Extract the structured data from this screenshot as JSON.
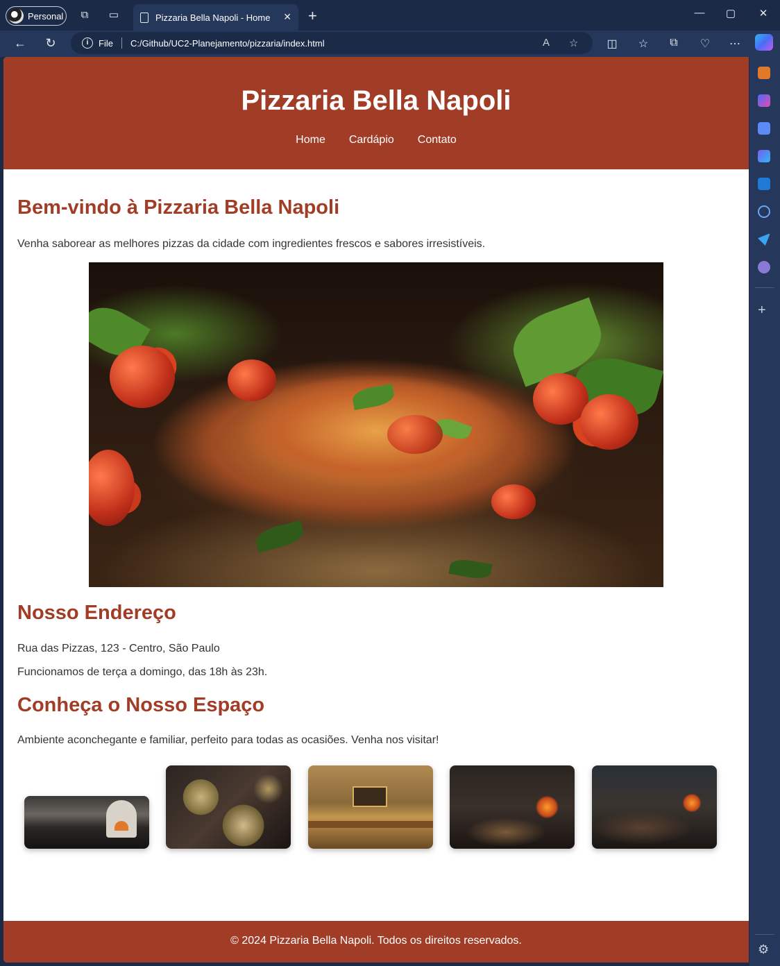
{
  "browser": {
    "profile_label": "Personal",
    "tab_title": "Pizzaria Bella Napoli - Home",
    "address_scheme": "File",
    "address_url": "C:/Github/UC2-Planejamento/pizzaria/index.html"
  },
  "site": {
    "title": "Pizzaria Bella Napoli",
    "nav": [
      "Home",
      "Cardápio",
      "Contato"
    ],
    "welcome_heading": "Bem-vindo à Pizzaria Bella Napoli",
    "welcome_text": "Venha saborear as melhores pizzas da cidade com ingredientes frescos e sabores irresistíveis.",
    "address_heading": "Nosso Endereço",
    "address_line": "Rua das Pizzas, 123 - Centro, São Paulo",
    "hours_line": "Funcionamos de terça a domingo, das 18h às 23h.",
    "space_heading": "Conheça o Nosso Espaço",
    "space_text": "Ambiente aconchegante e familiar, perfeito para todas as ocasiões. Venha nos visitar!",
    "footer": "© 2024 Pizzaria Bella Napoli. Todos os direitos reservados."
  },
  "colors": {
    "brand": "#a13d27",
    "browser_frame": "#1b2a47"
  }
}
